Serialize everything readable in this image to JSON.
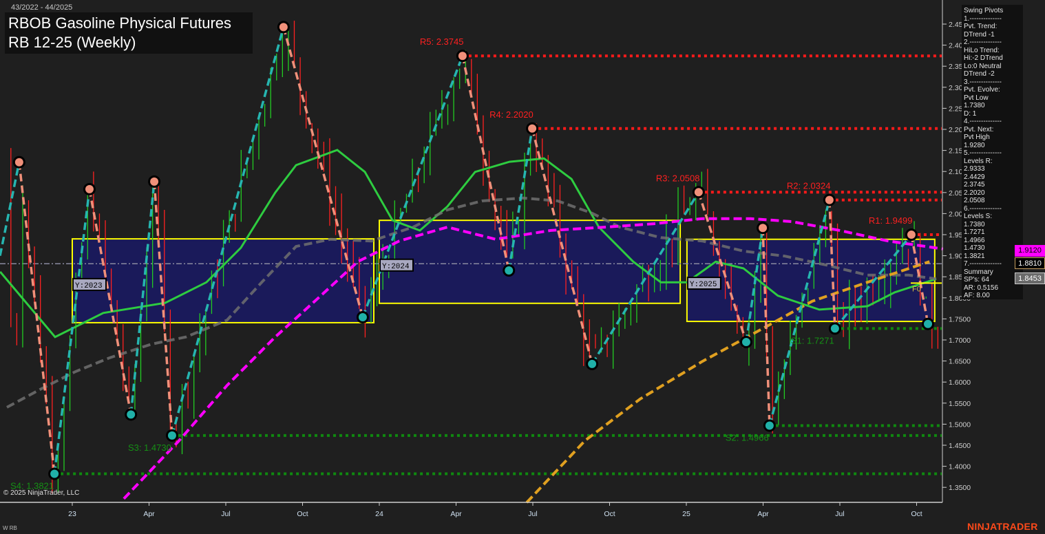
{
  "header": {
    "date_range": "43/2022 - 44/2025",
    "title_line1": "RBOB Gasoline Physical Futures",
    "title_line2": "RB 12-25 (Weekly)"
  },
  "info_panel": {
    "lines": [
      "Swing Pivots",
      "1.--------------",
      "Pvt. Trend:",
      "DTrend -1",
      "2.--------------",
      "HiLo Trend:",
      "Hi:-2 DTrend",
      "Lo:0 Neutral",
      "DTrend -2",
      "3.--------------",
      "Pvt. Evolve:",
      "Pvt Low",
      "1.7380",
      "D: 1",
      "4.--------------",
      "Pvt. Next:",
      "Pvt High",
      "1.9280",
      "5.--------------",
      "Levels R:",
      "2.9333",
      "2.4429",
      "2.3745",
      "2.2020",
      "2.0508",
      "6.--------------",
      "Levels S:",
      "1.7380",
      "1.7271",
      "1.4966",
      "1.4730",
      "1.3821",
      "7.--------------",
      "Summary",
      "SP's: 64",
      "AR: 0.5156",
      "AF: 8.00"
    ]
  },
  "price_tags": [
    {
      "value": "1.9120",
      "bg": "#ff00ff",
      "fg": "#000000"
    },
    {
      "value": "1.8810",
      "bg": "#000000",
      "fg": "#ffffff"
    },
    {
      "value": "1.8453",
      "bg": "#6a6a6a",
      "fg": "#ffffff"
    }
  ],
  "footer": {
    "copyright": "© 2025 NinjaTrader, LLC",
    "instrument": "W RB",
    "logo": "NINJATRADER"
  },
  "chart_data": {
    "type": "line",
    "title": "RBOB Gasoline Physical Futures RB 12-25 (Weekly)",
    "ylim": [
      1.32,
      2.48
    ],
    "xlim": [
      2022.76,
      2025.86
    ],
    "y_ticks": [
      "2.4500",
      "2.4000",
      "2.3500",
      "2.3000",
      "2.2500",
      "2.2000",
      "2.1500",
      "2.1000",
      "2.0500",
      "2.0000",
      "1.9500",
      "1.9000",
      "1.8500",
      "1.8000",
      "1.7500",
      "1.7000",
      "1.6500",
      "1.6000",
      "1.5500",
      "1.5000",
      "1.4500",
      "1.4000",
      "1.3500"
    ],
    "x_ticks": [
      {
        "t": 2023.0,
        "label": "23"
      },
      {
        "t": 2023.25,
        "label": "Apr"
      },
      {
        "t": 2023.5,
        "label": "Jul"
      },
      {
        "t": 2023.75,
        "label": "Oct"
      },
      {
        "t": 2024.0,
        "label": "24"
      },
      {
        "t": 2024.25,
        "label": "Apr"
      },
      {
        "t": 2024.5,
        "label": "Jul"
      },
      {
        "t": 2024.75,
        "label": "Oct"
      },
      {
        "t": 2025.0,
        "label": "25"
      },
      {
        "t": 2025.25,
        "label": "Apr"
      },
      {
        "t": 2025.5,
        "label": "Jul"
      },
      {
        "t": 2025.75,
        "label": "Oct"
      }
    ],
    "swing_pivots": [
      {
        "t": 2022.827,
        "p": 2.122,
        "type": "high"
      },
      {
        "t": 2022.942,
        "p": 1.3821,
        "type": "low"
      },
      {
        "t": 2023.056,
        "p": 2.058,
        "type": "high"
      },
      {
        "t": 2023.191,
        "p": 1.523,
        "type": "low"
      },
      {
        "t": 2023.267,
        "p": 2.076,
        "type": "high"
      },
      {
        "t": 2023.325,
        "p": 1.473,
        "type": "low"
      },
      {
        "t": 2023.688,
        "p": 2.4429,
        "type": "high"
      },
      {
        "t": 2023.946,
        "p": 1.754,
        "type": "low"
      },
      {
        "t": 2024.271,
        "p": 2.3745,
        "type": "high"
      },
      {
        "t": 2024.422,
        "p": 1.865,
        "type": "low"
      },
      {
        "t": 2024.498,
        "p": 2.202,
        "type": "high"
      },
      {
        "t": 2024.693,
        "p": 1.643,
        "type": "low"
      },
      {
        "t": 2025.04,
        "p": 2.0508,
        "type": "high"
      },
      {
        "t": 2025.195,
        "p": 1.695,
        "type": "low"
      },
      {
        "t": 2025.249,
        "p": 1.966,
        "type": "high"
      },
      {
        "t": 2025.271,
        "p": 1.4966,
        "type": "low"
      },
      {
        "t": 2025.466,
        "p": 2.0324,
        "type": "high"
      },
      {
        "t": 2025.484,
        "p": 1.7271,
        "type": "low"
      },
      {
        "t": 2025.733,
        "p": 1.9499,
        "type": "high"
      },
      {
        "t": 2025.787,
        "p": 1.738,
        "type": "low"
      }
    ],
    "levels": [
      {
        "label": "R5: 2.3745",
        "p": 2.3745,
        "from": 2024.271,
        "kind": "R"
      },
      {
        "label": "R4: 2.2020",
        "p": 2.202,
        "from": 2024.498,
        "kind": "R"
      },
      {
        "label": "R3: 2.0508",
        "p": 2.0508,
        "from": 2025.04,
        "kind": "R"
      },
      {
        "label": "R2: 2.0324",
        "p": 2.0324,
        "from": 2025.466,
        "kind": "R"
      },
      {
        "label": "R1: 1.9499",
        "p": 1.9499,
        "from": 2025.733,
        "kind": "R"
      },
      {
        "label": "S1: 1.7271",
        "p": 1.7271,
        "from": 2025.484,
        "kind": "S"
      },
      {
        "label": "S2: 1.4966",
        "p": 1.4966,
        "from": 2025.271,
        "kind": "S"
      },
      {
        "label": "S3: 1.4730",
        "p": 1.473,
        "from": 2023.325,
        "kind": "S"
      },
      {
        "label": "S4: 1.3821",
        "p": 1.3821,
        "from": 2022.942,
        "kind": "S"
      }
    ],
    "year_boxes": [
      {
        "label": "Y:2023",
        "t0": 2023.0,
        "t1": 2023.982,
        "top": 1.94,
        "bottom": 1.741
      },
      {
        "label": "Y:2024",
        "t0": 2024.0,
        "t1": 2024.98,
        "top": 1.984,
        "bottom": 1.787
      },
      {
        "label": "Y:2025",
        "t0": 2025.002,
        "t1": 2025.809,
        "top": 1.939,
        "bottom": 1.744
      }
    ],
    "f0": {
      "label": "F0",
      "p": 1.835
    },
    "reference_line": 1.881,
    "series": [
      {
        "name": "green-ma",
        "color": "#2ecc40",
        "points": [
          [
            2022.765,
            1.862
          ],
          [
            2022.944,
            1.707
          ],
          [
            2023.101,
            1.764
          ],
          [
            2023.303,
            1.788
          ],
          [
            2023.437,
            1.837
          ],
          [
            2023.549,
            1.919
          ],
          [
            2023.661,
            2.05
          ],
          [
            2023.729,
            2.115
          ],
          [
            2023.863,
            2.151
          ],
          [
            2023.953,
            2.099
          ],
          [
            2024.043,
            1.984
          ],
          [
            2024.132,
            1.96
          ],
          [
            2024.222,
            2.017
          ],
          [
            2024.312,
            2.099
          ],
          [
            2024.424,
            2.123
          ],
          [
            2024.536,
            2.131
          ],
          [
            2024.626,
            2.082
          ],
          [
            2024.715,
            1.968
          ],
          [
            2024.827,
            1.886
          ],
          [
            2024.917,
            1.837
          ],
          [
            2025.002,
            1.837
          ],
          [
            2025.096,
            1.886
          ],
          [
            2025.186,
            1.87
          ],
          [
            2025.298,
            1.805
          ],
          [
            2025.433,
            1.772
          ],
          [
            2025.59,
            1.78
          ],
          [
            2025.679,
            1.813
          ],
          [
            2025.814,
            1.845
          ]
        ]
      },
      {
        "name": "gray-ma",
        "color": "#707070",
        "dashed": true,
        "points": [
          [
            2022.787,
            1.54
          ],
          [
            2022.899,
            1.584
          ],
          [
            2023.011,
            1.625
          ],
          [
            2023.123,
            1.658
          ],
          [
            2023.258,
            1.69
          ],
          [
            2023.37,
            1.707
          ],
          [
            2023.504,
            1.747
          ],
          [
            2023.617,
            1.837
          ],
          [
            2023.729,
            1.922
          ],
          [
            2023.841,
            1.939
          ],
          [
            2023.975,
            1.935
          ],
          [
            2024.11,
            1.968
          ],
          [
            2024.222,
            2.009
          ],
          [
            2024.334,
            2.03
          ],
          [
            2024.469,
            2.037
          ],
          [
            2024.581,
            2.03
          ],
          [
            2024.693,
            2.001
          ],
          [
            2024.783,
            1.968
          ],
          [
            2024.917,
            1.943
          ],
          [
            2025.052,
            1.935
          ],
          [
            2025.186,
            1.911
          ],
          [
            2025.321,
            1.899
          ],
          [
            2025.455,
            1.878
          ],
          [
            2025.59,
            1.854
          ],
          [
            2025.724,
            1.854
          ],
          [
            2025.814,
            1.845
          ]
        ]
      },
      {
        "name": "magenta-ma",
        "color": "#ff00ff",
        "dashed": true,
        "points": [
          [
            2023.168,
            1.323
          ],
          [
            2023.348,
            1.461
          ],
          [
            2023.504,
            1.592
          ],
          [
            2023.661,
            1.707
          ],
          [
            2023.796,
            1.796
          ],
          [
            2023.93,
            1.886
          ],
          [
            2024.065,
            1.935
          ],
          [
            2024.222,
            1.968
          ],
          [
            2024.379,
            1.939
          ],
          [
            2024.558,
            1.96
          ],
          [
            2024.738,
            1.968
          ],
          [
            2024.895,
            1.976
          ],
          [
            2025.052,
            1.988
          ],
          [
            2025.209,
            1.988
          ],
          [
            2025.343,
            1.981
          ],
          [
            2025.5,
            1.96
          ],
          [
            2025.657,
            1.935
          ],
          [
            2025.836,
            1.916
          ]
        ]
      },
      {
        "name": "orange-ma",
        "color": "#e0a020",
        "dashed": true,
        "points": [
          [
            2024.48,
            1.314
          ],
          [
            2024.67,
            1.461
          ],
          [
            2024.85,
            1.56
          ],
          [
            2025.052,
            1.649
          ],
          [
            2025.231,
            1.72
          ],
          [
            2025.41,
            1.792
          ],
          [
            2025.59,
            1.837
          ],
          [
            2025.792,
            1.886
          ]
        ]
      }
    ],
    "colors": {
      "up": "#22cc22",
      "down": "#ff2020",
      "box": "#ffff00",
      "box_fill": "#1a1a5e",
      "zig_up": "#26b5b0",
      "zig_down": "#f0907a"
    }
  }
}
